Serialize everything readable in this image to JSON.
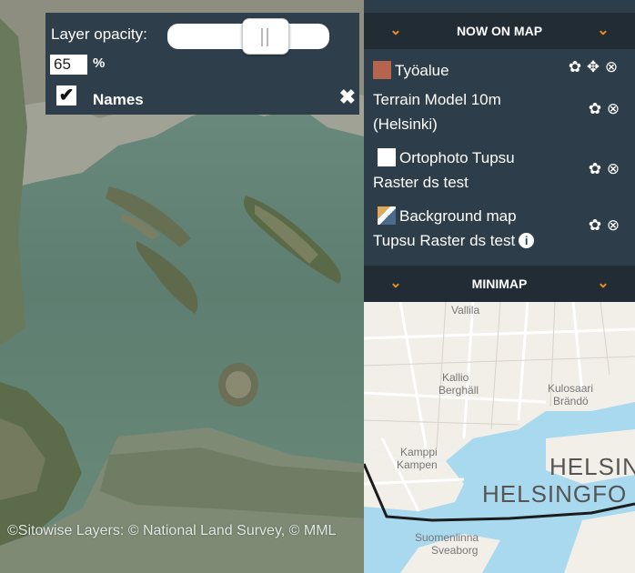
{
  "opacity_popup": {
    "label": "Layer opacity:",
    "value": "65",
    "percent_sign": "%",
    "slider_value_percent": 65,
    "names_checked": true,
    "names_label": "Names",
    "close_glyph": "✖"
  },
  "now_on_map": {
    "title": "NOW ON MAP",
    "chevron_glyph": "⌄",
    "layers": [
      {
        "name": "Työalue",
        "swatch_color": "#b5654f",
        "tools": [
          "gear-icon",
          "move-icon",
          "remove-icon"
        ]
      },
      {
        "name_line1": "Terrain Model 10m",
        "name_line2": "(Helsinki)",
        "tools": [
          "gear-icon",
          "remove-icon"
        ]
      },
      {
        "name_line1": "Ortophoto Tupsu",
        "name_line2": "Raster ds test",
        "swatch_color": "#ffffff",
        "tools": [
          "gear-icon",
          "remove-icon"
        ]
      },
      {
        "name_line1": "Background map",
        "name_line2": "Tupsu Raster ds test",
        "info_glyph": "i",
        "tools": [
          "gear-icon",
          "remove-icon"
        ]
      }
    ],
    "gear_glyph": "✿",
    "move_glyph": "✥",
    "remove_glyph": "⊗"
  },
  "minimap": {
    "title": "MINIMAP",
    "labels": {
      "kallio": "Kallio",
      "berghall": "Berghäll",
      "kulosaari": "Kulosaari",
      "brando": "Brändö",
      "kamppi": "Kamppi",
      "kampen": "Kampen",
      "helsinki": "HELSIN",
      "helsingfors": "HELSINGFO",
      "suomenlinna": "Suomenlinna",
      "sveaborg": "Sveaborg",
      "top_label": "Vallila"
    }
  },
  "attribution": "©Sitowise Layers: © National Land Survey, © MML",
  "colors": {
    "panel_bg": "#2d3d49",
    "header_bg": "#222c35",
    "accent_orange": "#f28a22",
    "popup_bg": "#2e3f4b"
  }
}
